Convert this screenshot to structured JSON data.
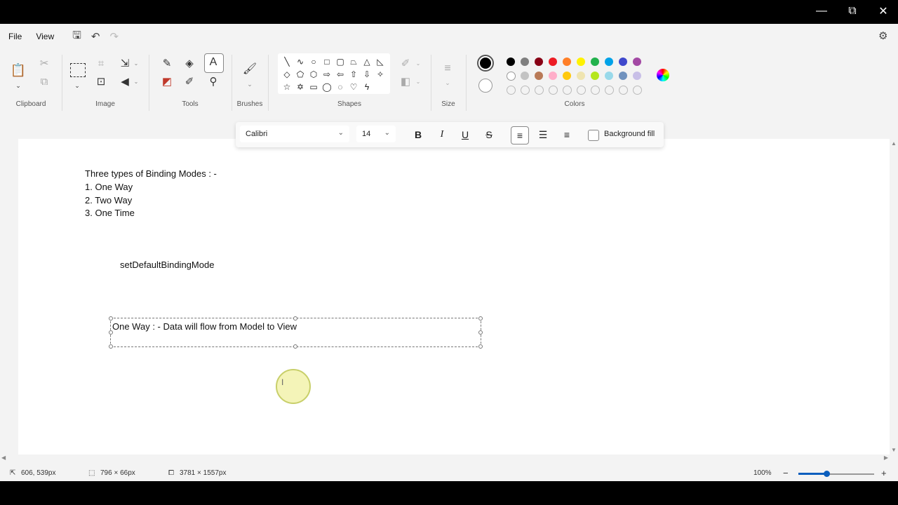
{
  "window": {
    "minimize": "—",
    "restore": "⧉",
    "close": "✕"
  },
  "menu": {
    "file": "File",
    "view": "View"
  },
  "ribbon": {
    "clipboard_label": "Clipboard",
    "image_label": "Image",
    "tools_label": "Tools",
    "brushes_label": "Brushes",
    "shapes_label": "Shapes",
    "size_label": "Size",
    "colors_label": "Colors"
  },
  "colors": {
    "primary": "#000000",
    "secondary": "#ffffff",
    "row1": [
      "#000000",
      "#7f7f7f",
      "#880015",
      "#ed1c24",
      "#ff7f27",
      "#fff200",
      "#22b14c",
      "#00a2e8",
      "#3f48cc",
      "#a349a4"
    ],
    "row2": [
      "#ffffff",
      "#c3c3c3",
      "#b97a57",
      "#ffaec9",
      "#ffc90e",
      "#efe4b0",
      "#b5e61d",
      "#99d9ea",
      "#7092be",
      "#c8bfe7"
    ]
  },
  "textbar": {
    "font": "Calibri",
    "size": "14",
    "bold": "B",
    "italic": "I",
    "underline": "U",
    "strike": "S",
    "background_fill": "Background fill"
  },
  "canvas": {
    "line1": "Three types of Binding Modes : -",
    "line2": "1. One Way",
    "line3": "2. Two Way",
    "line4": "3. One Time",
    "method": "setDefaultBindingMode",
    "textbox": "One Way : - Data will flow from Model to View"
  },
  "status": {
    "cursor_pos": "606, 539px",
    "selection_size": "796 × 66px",
    "canvas_size": "3781 × 1557px",
    "zoom": "100%",
    "zoom_level": 0.37
  }
}
